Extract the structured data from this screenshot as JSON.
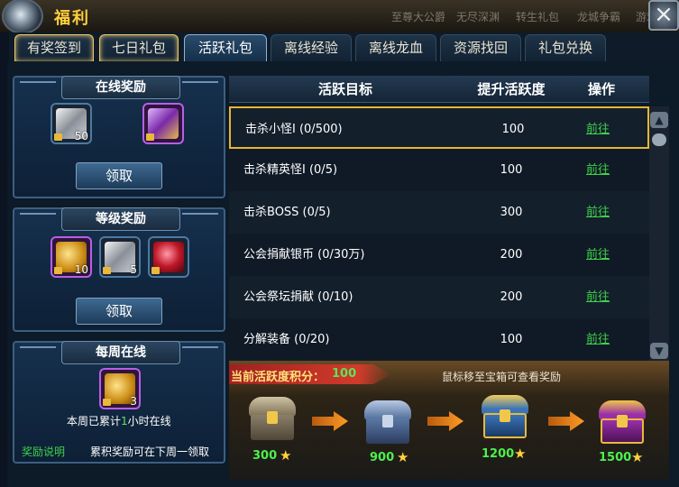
{
  "window": {
    "title": "福利",
    "bg_menu": [
      "至尊大公爵",
      "无尽深渊",
      "转生礼包",
      "龙城争霸",
      "游戏"
    ],
    "close_label": "×"
  },
  "tabs": [
    {
      "label": "有奖签到",
      "state": "highlight"
    },
    {
      "label": "七日礼包",
      "state": "highlight"
    },
    {
      "label": "活跃礼包",
      "state": "active"
    },
    {
      "label": "离线经验",
      "state": "normal"
    },
    {
      "label": "离线龙血",
      "state": "normal"
    },
    {
      "label": "资源找回",
      "state": "normal"
    },
    {
      "label": "礼包兑换",
      "state": "normal"
    }
  ],
  "online_reward": {
    "title": "在线奖励",
    "items": [
      {
        "icon": "silver-ingot-icon",
        "count": "50"
      },
      {
        "icon": "scroll-icon",
        "count": ""
      }
    ],
    "button": "领取"
  },
  "level_reward": {
    "title": "等级奖励",
    "items": [
      {
        "icon": "gold-coins-icon",
        "count": "10"
      },
      {
        "icon": "silver-ingot-icon",
        "count": "5"
      },
      {
        "icon": "red-gem-icon",
        "count": ""
      }
    ],
    "button": "领取"
  },
  "weekly_online": {
    "title": "每周在线",
    "item": {
      "icon": "gold-coins-icon",
      "count": "3"
    },
    "text_prefix": "本周已累计",
    "hours": "1",
    "text_suffix": "小时在线",
    "rules_link": "奖励说明",
    "note": "累积奖励可在下周一领取"
  },
  "table": {
    "headers": [
      "活跃目标",
      "提升活跃度",
      "操作"
    ],
    "rows": [
      {
        "goal": "击杀小怪I  (0/500)",
        "points": "100",
        "action": "前往",
        "selected": true
      },
      {
        "goal": "击杀精英怪I  (0/5)",
        "points": "100",
        "action": "前往",
        "selected": false
      },
      {
        "goal": "击杀BOSS  (0/5)",
        "points": "300",
        "action": "前往",
        "selected": false
      },
      {
        "goal": "公会捐献银币  (0/30万)",
        "points": "200",
        "action": "前往",
        "selected": false
      },
      {
        "goal": "公会祭坛捐献  (0/10)",
        "points": "200",
        "action": "前往",
        "selected": false
      },
      {
        "goal": "分解装备  (0/20)",
        "points": "100",
        "action": "前往",
        "selected": false
      }
    ]
  },
  "activity": {
    "points_label": "当前活跃度积分：",
    "points_value": "100",
    "hint": "鼠标移至宝箱可查看奖励",
    "chests": [
      {
        "name": "wooden-chest",
        "required": "300",
        "color": "#8a7f6a"
      },
      {
        "name": "silver-chest",
        "required": "900",
        "color": "#5c78a6"
      },
      {
        "name": "gold-chest",
        "required": "1200",
        "color": "#3a74b8"
      },
      {
        "name": "purple-chest",
        "required": "1500",
        "color": "#9a2fa8"
      }
    ]
  },
  "colors": {
    "accent_gold": "#ffcf3a",
    "link_green": "#3fd14a",
    "value_green": "#5be55b"
  }
}
